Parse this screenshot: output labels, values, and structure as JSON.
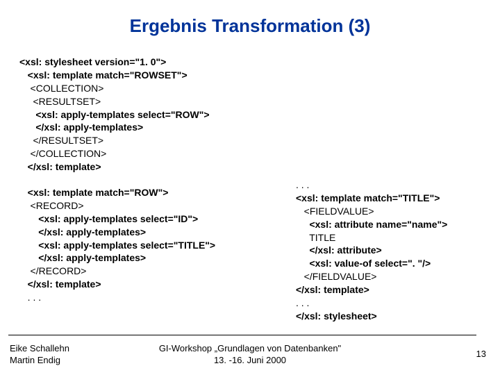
{
  "title": "Ergebnis Transformation (3)",
  "code": {
    "l1": "<xsl: stylesheet version=\"1. 0\">",
    "l2": "   <xsl: template match=\"ROWSET\">",
    "l3": "    <COLLECTION>",
    "l4": "     <RESULTSET>",
    "l5": "      <xsl: apply-templates select=\"ROW\">",
    "l6": "      </xsl: apply-templates>",
    "l7": "     </RESULTSET>",
    "l8": "    </COLLECTION>",
    "l9": "   </xsl: template>",
    "l10": "   <xsl: template match=\"ROW\">",
    "l11": "    <RECORD>",
    "l12": "       <xsl: apply-templates select=\"ID\">",
    "l13": "       </xsl: apply-templates>",
    "l14": "       <xsl: apply-templates select=\"TITLE\">",
    "l15": "       </xsl: apply-templates>",
    "l16": "    </RECORD>",
    "l17": "   </xsl: template>",
    "l18": "   . . .",
    "r0": ". . .",
    "r1": "<xsl: template match=\"TITLE\">",
    "r2": "   <FIELDVALUE>",
    "r3": "     <xsl: attribute name=\"name\">",
    "r4": "     TITLE",
    "r5": "     </xsl: attribute>",
    "r6": "     <xsl: value-of select=\". \"/>",
    "r7": "   </FIELDVALUE>",
    "r8": "</xsl: template>",
    "r9": ". . .",
    "r10": "</xsl: stylesheet>"
  },
  "footer": {
    "author1": "Eike Schallehn",
    "author2": "Martin Endig",
    "workshop": "GI-Workshop „Grundlagen von Datenbanken\"",
    "dates": "13. -16. Juni 2000",
    "page": "13"
  }
}
